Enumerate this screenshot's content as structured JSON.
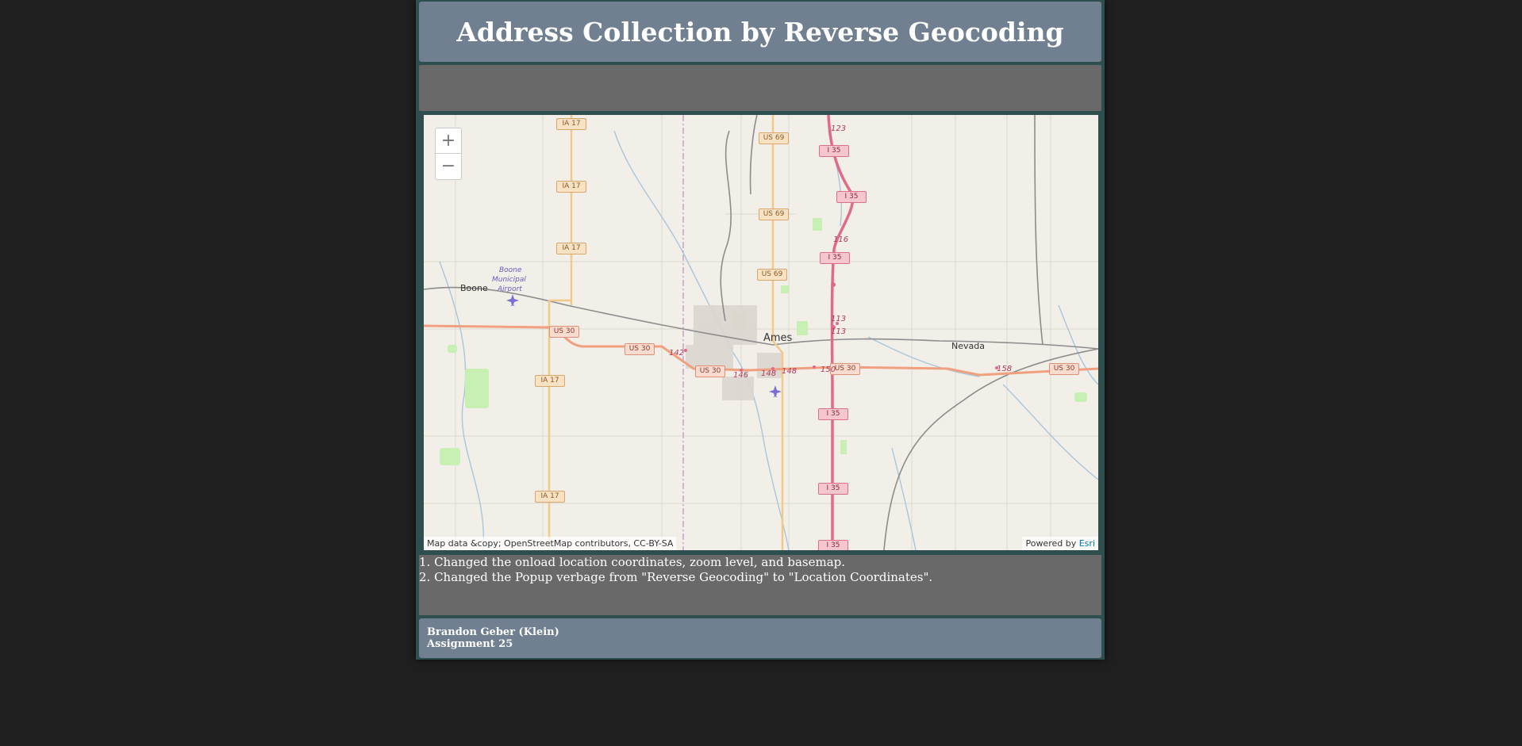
{
  "header": {
    "title": "Address Collection by Reverse Geocoding"
  },
  "map": {
    "zoom_in_label": "+",
    "zoom_out_label": "−",
    "attribution_left": "Map data &copy; OpenStreetMap contributors, CC-BY-SA",
    "attribution_powered": "Powered by ",
    "attribution_esri": "Esri",
    "places": {
      "ames": "Ames",
      "boone": "Boone",
      "nevada": "Nevada",
      "airport_line1": "Boone",
      "airport_line2": "Municipal",
      "airport_line3": "Airport"
    },
    "shields": {
      "ia17": "IA 17",
      "us69": "US 69",
      "us30": "US 30",
      "i35": "I 35"
    },
    "exits": [
      "123",
      "116",
      "113",
      "113",
      "142",
      "146",
      "148",
      "148",
      "150",
      "158"
    ],
    "colors": {
      "land": "#f2efe9",
      "interstate": "#e06b86",
      "us_highway": "#f0a07e",
      "state_highway": "#f2c98a",
      "park": "#c8f0b4",
      "water": "#a8c6dc",
      "county_line": "#c8a0d0"
    }
  },
  "notes": [
    "1. Changed the onload location coordinates, zoom level, and basemap.",
    "2. Changed the Popup verbage from \"Reverse Geocoding\" to \"Location Coordinates\"."
  ],
  "footer": {
    "author": "Brandon Geber (Klein)",
    "assignment": "Assignment 25"
  }
}
